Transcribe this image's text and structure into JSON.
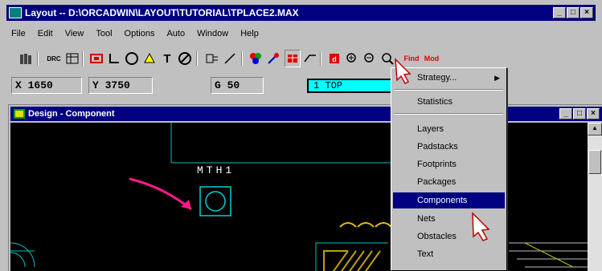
{
  "app": {
    "title": "Layout -- D:\\ORCADWIN\\LAYOUT\\TUTORIAL\\TPLACE2.MAX",
    "window_buttons": [
      "_",
      "□",
      "×"
    ]
  },
  "menu_bar": [
    "File",
    "Edit",
    "View",
    "Tool",
    "Options",
    "Auto",
    "Window",
    "Help"
  ],
  "toolbar": {
    "text_button": "T",
    "drc_label": "DRC",
    "find_label": "Find",
    "mod_label": "Mod"
  },
  "coords": {
    "x_label": "X",
    "x_value": "1650",
    "y_label": "Y",
    "y_value": "3750",
    "g_label": "G",
    "g_value": "50",
    "layer": "1  TOP"
  },
  "design_window": {
    "title": "Design - Component",
    "component_label": "MTH1"
  },
  "dropdown": {
    "items": [
      "Strategy...",
      "Statistics",
      "Layers",
      "Padstacks",
      "Footprints",
      "Packages",
      "Components",
      "Nets",
      "Obstacles",
      "Text"
    ],
    "selected": "Components"
  },
  "colors": {
    "titlebar": "#000080",
    "layer_field": "#00ffff",
    "canvas": "#000000",
    "annotation_arrow": "#ff1a8c"
  }
}
